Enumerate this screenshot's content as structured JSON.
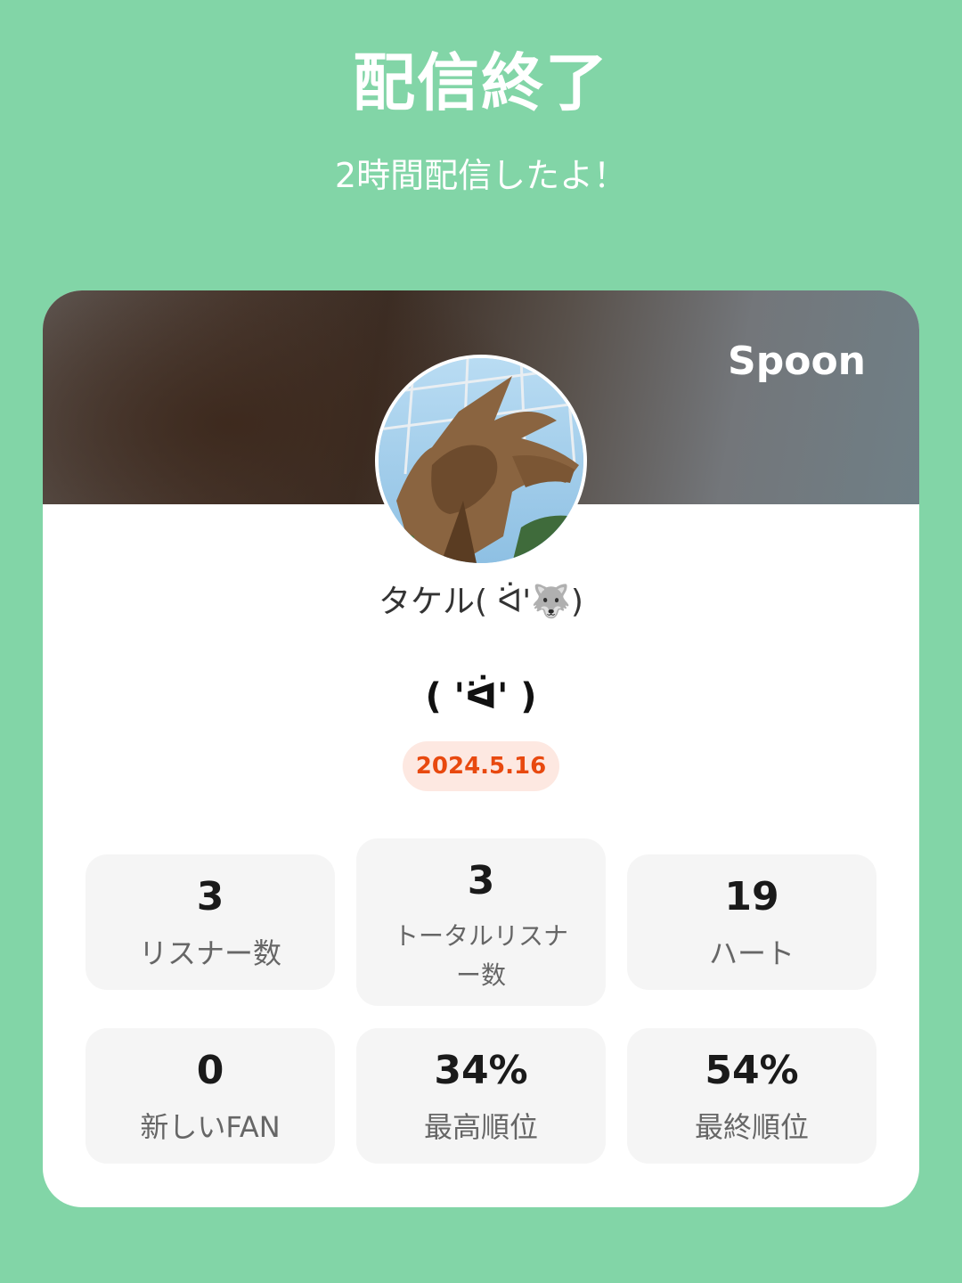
{
  "header": {
    "title": "配信終了",
    "subtitle": "2時間配信したよ！"
  },
  "card": {
    "brand": "Spoon",
    "username": "タケル( ᐛ'🐺)",
    "broadcast_title": "( 'ᐛ' )",
    "date": "2024.5.16"
  },
  "stats": [
    {
      "value": "3",
      "label": "リスナー数"
    },
    {
      "value": "3",
      "label": "トータルリスナー数"
    },
    {
      "value": "19",
      "label": "ハート"
    },
    {
      "value": "0",
      "label": "新しいFAN"
    },
    {
      "value": "34%",
      "label": "最高順位"
    },
    {
      "value": "54%",
      "label": "最終順位"
    }
  ],
  "colors": {
    "background": "#82d5a7",
    "date_accent": "#e8490f",
    "date_badge_bg": "#fde8e1"
  }
}
